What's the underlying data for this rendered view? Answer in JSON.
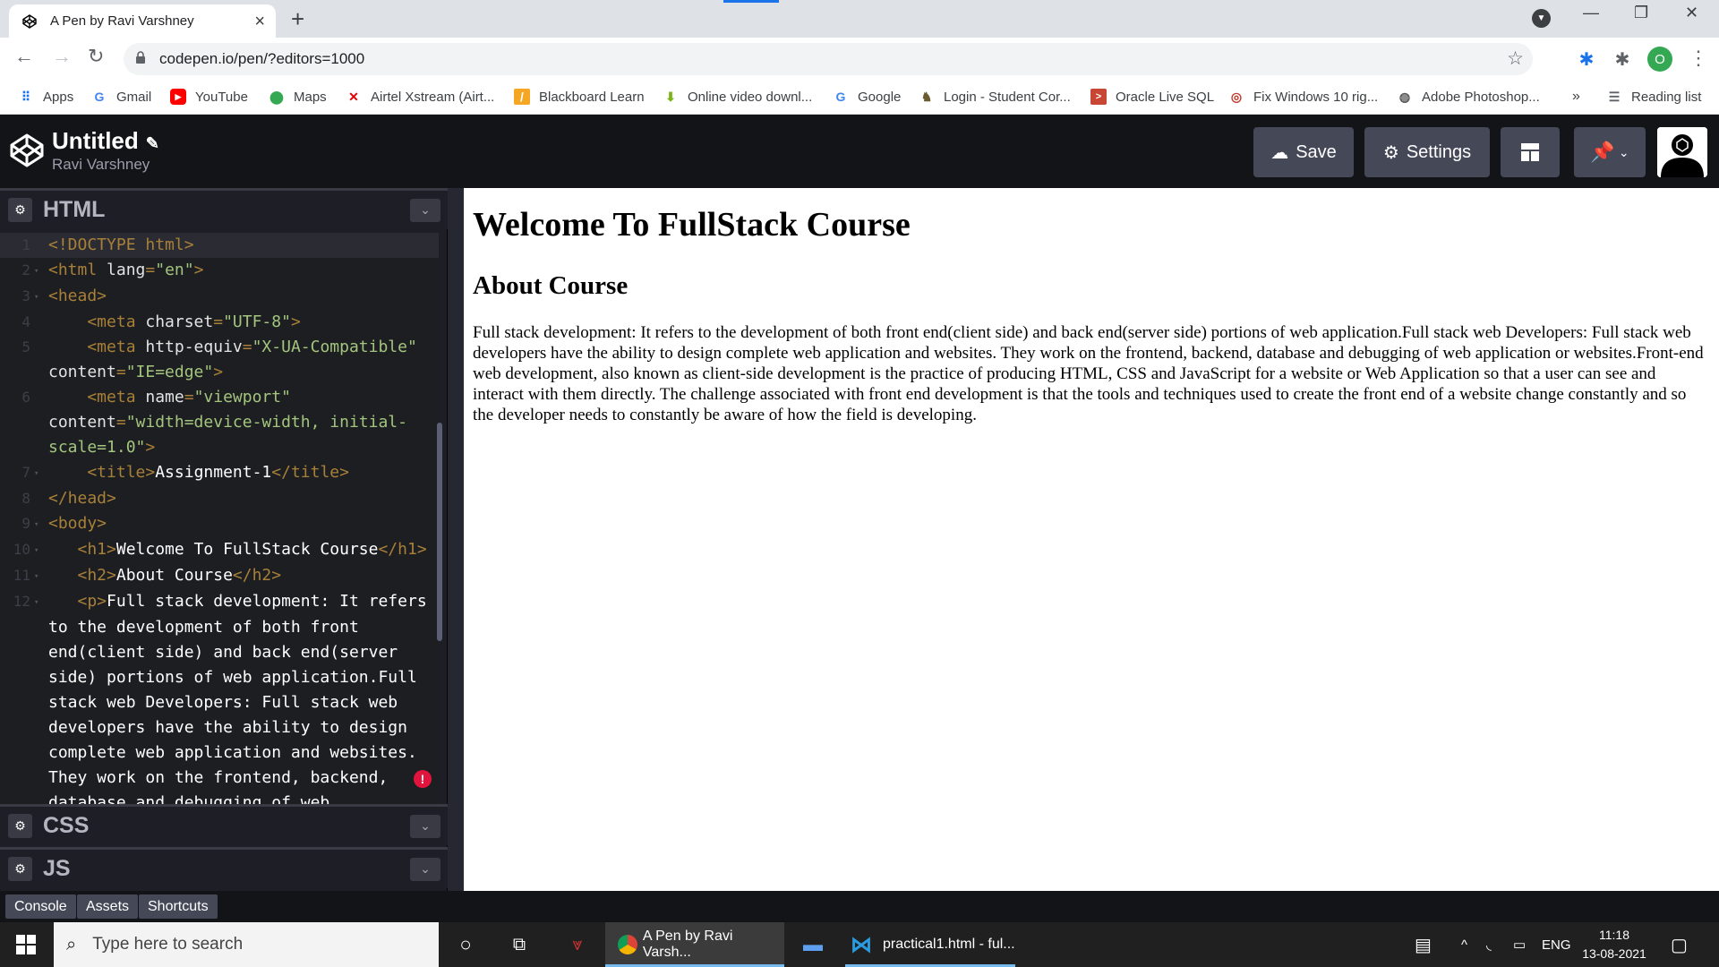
{
  "browser": {
    "tab_title": "A Pen by Ravi Varshney",
    "url": "codepen.io/pen/?editors=1000",
    "profile_initial": "O",
    "bookmarks": [
      "Apps",
      "Gmail",
      "YouTube",
      "Maps",
      "Airtel Xstream (Airt...",
      "Blackboard Learn",
      "Online video downl...",
      "Google",
      "Login - Student Cor...",
      "Oracle Live SQL",
      "Fix Windows 10 rig...",
      "Adobe Photoshop..."
    ],
    "more_bookmarks": "»",
    "reading_list": "Reading list"
  },
  "codepen": {
    "pen_title": "Untitled",
    "author": "Ravi Varshney",
    "save_label": "Save",
    "settings_label": "Settings",
    "editors": {
      "html": "HTML",
      "css": "CSS",
      "js": "JS"
    },
    "bottom": {
      "console": "Console",
      "assets": "Assets",
      "shortcuts": "Shortcuts"
    }
  },
  "code_lines": [
    {
      "n": "1",
      "segs": [
        [
          "tg",
          "<!DOCTYPE html>"
        ]
      ]
    },
    {
      "n": "2",
      "segs": [
        [
          "tg",
          "<html "
        ],
        [
          "at",
          "lang"
        ],
        [
          "tg",
          "="
        ],
        [
          "st",
          "\"en\""
        ],
        [
          "tg",
          ">"
        ]
      ]
    },
    {
      "n": "3",
      "segs": [
        [
          "tg",
          "<head>"
        ]
      ]
    },
    {
      "n": "4",
      "segs": [
        [
          "tg",
          "    <meta "
        ],
        [
          "at",
          "charset"
        ],
        [
          "tg",
          "="
        ],
        [
          "st",
          "\"UTF-8\""
        ],
        [
          "tg",
          ">"
        ]
      ]
    },
    {
      "n": "5",
      "segs": [
        [
          "tg",
          "    <meta "
        ],
        [
          "at",
          "http-equiv"
        ],
        [
          "tg",
          "="
        ],
        [
          "st",
          "\"X-UA-Compatible\""
        ]
      ]
    },
    {
      "n": "",
      "segs": [
        [
          "at",
          "content"
        ],
        [
          "tg",
          "="
        ],
        [
          "st",
          "\"IE=edge\""
        ],
        [
          "tg",
          ">"
        ]
      ]
    },
    {
      "n": "6",
      "segs": [
        [
          "tg",
          "    <meta "
        ],
        [
          "at",
          "name"
        ],
        [
          "tg",
          "="
        ],
        [
          "st",
          "\"viewport\""
        ]
      ]
    },
    {
      "n": "",
      "segs": [
        [
          "at",
          "content"
        ],
        [
          "tg",
          "="
        ],
        [
          "st",
          "\"width=device-width, initial-"
        ]
      ]
    },
    {
      "n": "",
      "segs": [
        [
          "st",
          "scale=1.0\""
        ],
        [
          "tg",
          ">"
        ]
      ]
    },
    {
      "n": "7",
      "segs": [
        [
          "tg",
          "    <title>"
        ],
        [
          "tx",
          "Assignment-1"
        ],
        [
          "tg",
          "</title>"
        ]
      ]
    },
    {
      "n": "8",
      "segs": [
        [
          "tg",
          "</head>"
        ]
      ]
    },
    {
      "n": "9",
      "segs": [
        [
          "tg",
          "<body>"
        ]
      ]
    },
    {
      "n": "10",
      "segs": [
        [
          "tg",
          "   <h1>"
        ],
        [
          "tx",
          "Welcome To FullStack Course"
        ],
        [
          "tg",
          "</h1>"
        ]
      ]
    },
    {
      "n": "11",
      "segs": [
        [
          "tg",
          "   <h2>"
        ],
        [
          "tx",
          "About Course"
        ],
        [
          "tg",
          "</h2>"
        ]
      ]
    },
    {
      "n": "12",
      "segs": [
        [
          "tg",
          "   <p>"
        ],
        [
          "tx",
          "Full stack development: It refers"
        ]
      ]
    },
    {
      "n": "",
      "segs": [
        [
          "tx",
          "to the development of both front"
        ]
      ]
    },
    {
      "n": "",
      "segs": [
        [
          "tx",
          "end(client side) and back end(server"
        ]
      ]
    },
    {
      "n": "",
      "segs": [
        [
          "tx",
          "side) portions of web application.Full"
        ]
      ]
    },
    {
      "n": "",
      "segs": [
        [
          "tx",
          "stack web Developers: Full stack web"
        ]
      ]
    },
    {
      "n": "",
      "segs": [
        [
          "tx",
          "developers have the ability to design"
        ]
      ]
    },
    {
      "n": "",
      "segs": [
        [
          "tx",
          "complete web application and websites."
        ]
      ]
    },
    {
      "n": "",
      "segs": [
        [
          "tx",
          "They work on the frontend, backend,"
        ]
      ]
    },
    {
      "n": "",
      "segs": [
        [
          "tx",
          "database and debugging of web"
        ]
      ]
    }
  ],
  "preview": {
    "h1": "Welcome To FullStack Course",
    "h2": "About Course",
    "p": "Full stack development: It refers to the development of both front end(client side) and back end(server side) portions of web application.Full stack web Developers: Full stack web developers have the ability to design complete web application and websites. They work on the frontend, backend, database and debugging of web application or websites.Front-end web development, also known as client-side development is the practice of producing HTML, CSS and JavaScript for a website or Web Application so that a user can see and interact with them directly. The challenge associated with front end development is that the tools and techniques used to create the front end of a website change constantly and so the developer needs to constantly be aware of how the field is developing."
  },
  "taskbar": {
    "search_placeholder": "Type here to search",
    "chrome_label": "A Pen by Ravi Varsh...",
    "vscode_label": "practical1.html - ful...",
    "lang": "ENG",
    "time": "11:18",
    "date": "13-08-2021"
  }
}
